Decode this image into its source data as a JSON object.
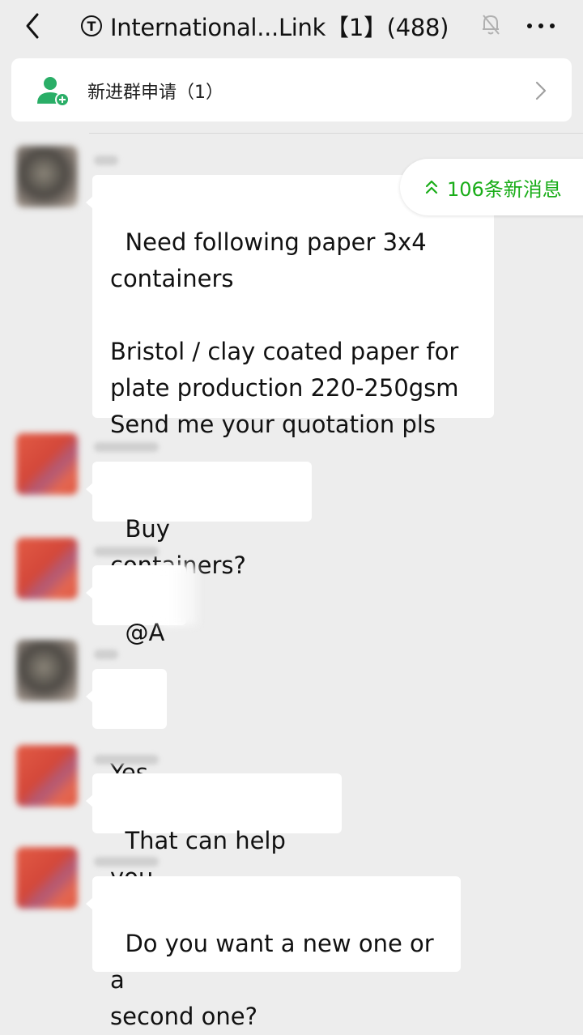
{
  "header": {
    "badge_letter": "T",
    "title": "International...Link【1】(488)"
  },
  "join_request": {
    "label": "新进群申请（1）"
  },
  "new_messages_pill": {
    "label": "106条新消息"
  },
  "colors": {
    "background": "#ededed",
    "bubble": "#ffffff",
    "accent_green": "#1aad19"
  },
  "icons": {
    "back": "chevron-left-icon",
    "mute": "bell-off-icon",
    "more": "more-dots-icon",
    "join": "add-user-icon",
    "chevron": "chevron-right-icon",
    "new_messages": "double-chevron-up-icon"
  },
  "messages": [
    {
      "text": "Need following paper 3x4\ncontainers\n\nBristol / clay coated paper for\nplate production 220-250gsm\nSend me your quotation pls"
    },
    {
      "text": "Buy containers?"
    },
    {
      "text": "@A"
    },
    {
      "text": "Yes"
    },
    {
      "text": "That can help you."
    },
    {
      "text": "Do you want a new one or a\nsecond one?"
    }
  ]
}
